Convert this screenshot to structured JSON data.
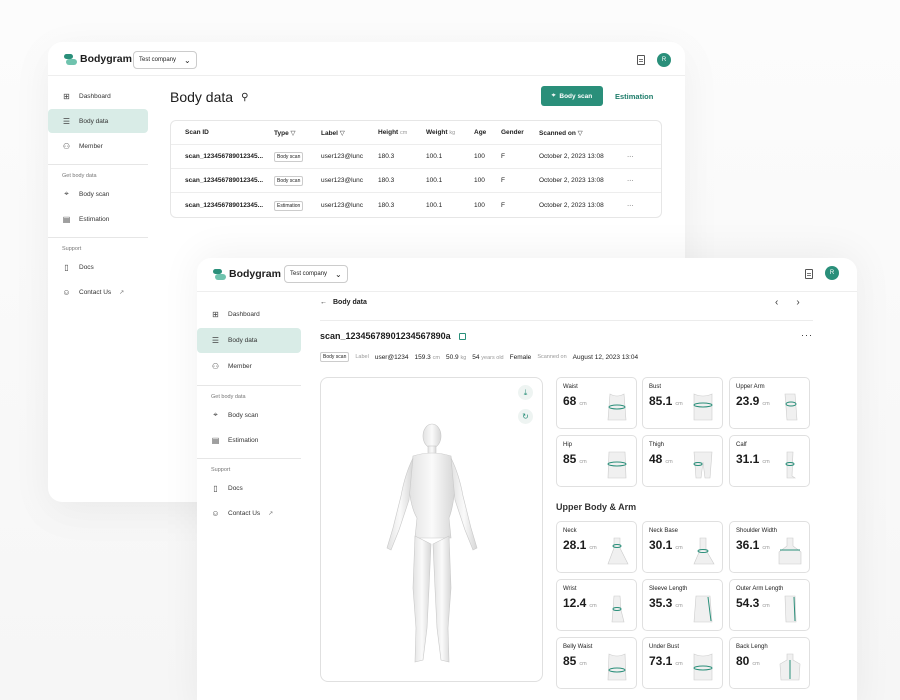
{
  "brand": "Bodygram",
  "company": "Test company",
  "avatar_initial": "R",
  "accent_color": "#2a8f7a",
  "sidebar": {
    "items": [
      {
        "label": "Dashboard",
        "icon": "dashboard-icon"
      },
      {
        "label": "Body data",
        "icon": "database-icon"
      },
      {
        "label": "Member",
        "icon": "users-icon"
      }
    ],
    "section_body": "Get body data",
    "body_items": [
      {
        "label": "Body scan",
        "icon": "scan-icon"
      },
      {
        "label": "Estimation",
        "icon": "estimation-icon"
      }
    ],
    "section_support": "Support",
    "support_items": [
      {
        "label": "Docs",
        "icon": "docs-icon"
      },
      {
        "label": "Contact Us",
        "icon": "contact-icon"
      }
    ]
  },
  "list_page": {
    "title": "Body data",
    "scan_button": "Body scan",
    "estimation_button": "Estimation",
    "columns": [
      "Scan ID",
      "Type",
      "Label",
      "Height",
      "cm",
      "Weight",
      "kg",
      "Age",
      "Gender",
      "Scanned on"
    ],
    "rows": [
      {
        "id": "scan_123456789012345...",
        "type": "Body scan",
        "label": "user123@lunc",
        "height": "180.3",
        "weight": "100.1",
        "age": "100",
        "gender": "F",
        "scanned": "October 2, 2023 13:08"
      },
      {
        "id": "scan_123456789012345...",
        "type": "Body scan",
        "label": "user123@lunc",
        "height": "180.3",
        "weight": "100.1",
        "age": "100",
        "gender": "F",
        "scanned": "October 2, 2023 13:08"
      },
      {
        "id": "scan_123456789012345...",
        "type": "Estimation",
        "label": "user123@lunc",
        "height": "180.3",
        "weight": "100.1",
        "age": "100",
        "gender": "F",
        "scanned": "October 2, 2023 13:08"
      }
    ],
    "row_menu": "···"
  },
  "detail_page": {
    "back_label": "Body data",
    "scan_id": "scan_12345678901234567890a",
    "more": "···",
    "meta": {
      "type": "Body scan",
      "label_key": "Label",
      "label_val": "user@1234",
      "height": "159.3",
      "height_unit": "cm",
      "weight": "50.9",
      "weight_unit": "kg",
      "age": "54",
      "age_unit": "years old",
      "gender": "Female",
      "scanned_key": "Scanned on",
      "scanned_val": "August 12, 2023 13:04"
    },
    "top_cards": [
      {
        "name": "Waist",
        "value": "68",
        "unit": "cm"
      },
      {
        "name": "Bust",
        "value": "85.1",
        "unit": "cm"
      },
      {
        "name": "Upper Arm",
        "value": "23.9",
        "unit": "cm"
      },
      {
        "name": "Hip",
        "value": "85",
        "unit": "cm"
      },
      {
        "name": "Thigh",
        "value": "48",
        "unit": "cm"
      },
      {
        "name": "Calf",
        "value": "31.1",
        "unit": "cm"
      }
    ],
    "section_title": "Upper Body & Arm",
    "upper_cards": [
      {
        "name": "Neck",
        "value": "28.1",
        "unit": "cm"
      },
      {
        "name": "Neck Base",
        "value": "30.1",
        "unit": "cm"
      },
      {
        "name": "Shoulder Width",
        "value": "36.1",
        "unit": "cm"
      },
      {
        "name": "Wrist",
        "value": "12.4",
        "unit": "cm"
      },
      {
        "name": "Sleeve Length",
        "value": "35.3",
        "unit": "cm"
      },
      {
        "name": "Outer Arm Length",
        "value": "54.3",
        "unit": "cm"
      },
      {
        "name": "Belly Waist",
        "value": "85",
        "unit": "cm"
      },
      {
        "name": "Under Bust",
        "value": "73.1",
        "unit": "cm"
      },
      {
        "name": "Back Lengh",
        "value": "80",
        "unit": "cm"
      }
    ]
  }
}
